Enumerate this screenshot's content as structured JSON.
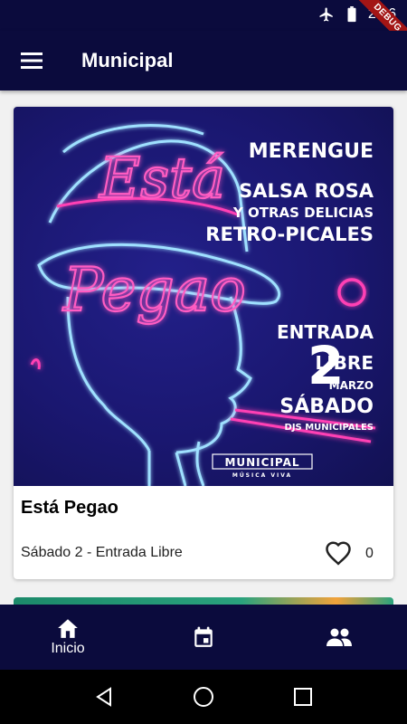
{
  "status_bar": {
    "time": "2:36",
    "debug_label": "DEBUG"
  },
  "app_bar": {
    "title": "Municipal"
  },
  "event_card": {
    "poster": {
      "headline_line1": "Está",
      "headline_line2": "Pegao",
      "genre_1": "MERENGUE",
      "genre_2": "SALSA ROSA",
      "genre_3": "Y OTRAS DELICIAS",
      "genre_4": "RETRO-PICALES",
      "entry_1": "ENTRADA",
      "entry_2": "LIBRE",
      "day_number": "2",
      "month": "MARZO",
      "weekday": "SÁBADO",
      "djs": "DJS MUNICIPALES",
      "logo_text": "MUNICIPAL",
      "logo_sub": "MÚSICA VIVA"
    },
    "title": "Está Pegao",
    "subtitle": "Sábado 2 - Entrada Libre",
    "likes": "0"
  },
  "bottom_nav": {
    "items": [
      {
        "label": "Inicio",
        "icon": "home-icon"
      },
      {
        "label": "",
        "icon": "calendar-icon"
      },
      {
        "label": "",
        "icon": "people-icon"
      }
    ]
  },
  "colors": {
    "primary": "#0b0b3d",
    "neon_pink": "#ff3fb4",
    "neon_blue": "#8fd8ff"
  }
}
